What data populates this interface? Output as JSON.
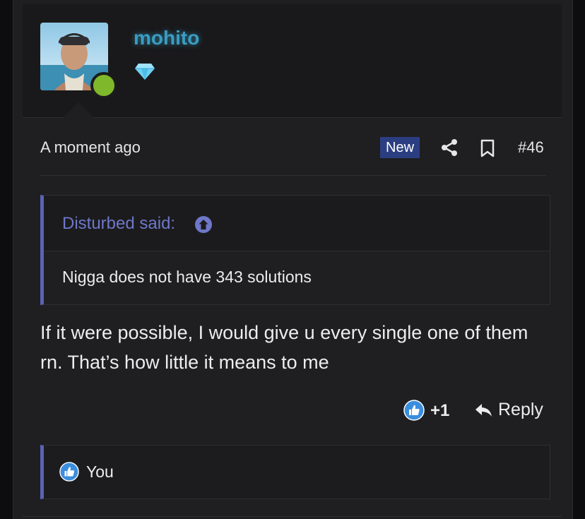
{
  "user": {
    "name": "mohito",
    "online": true,
    "badge_icon": "diamond-icon"
  },
  "post": {
    "time": "A moment ago",
    "new_label": "New",
    "number": "#46",
    "quote": {
      "author": "Disturbed said:",
      "text": "Nigga does not have 343 solutions"
    },
    "message": "If it were possible, I would give u every single one of them rn. That’s how little it means to me",
    "like_count": "+1",
    "reply_label": "Reply",
    "reactions": {
      "users": "You"
    }
  },
  "colors": {
    "username": "#3a9dc2",
    "accent_bar": "#5b62b5",
    "new_badge": "#2c3e82",
    "online_dot": "#7fb82a",
    "like_blue": "#3b8ede"
  }
}
